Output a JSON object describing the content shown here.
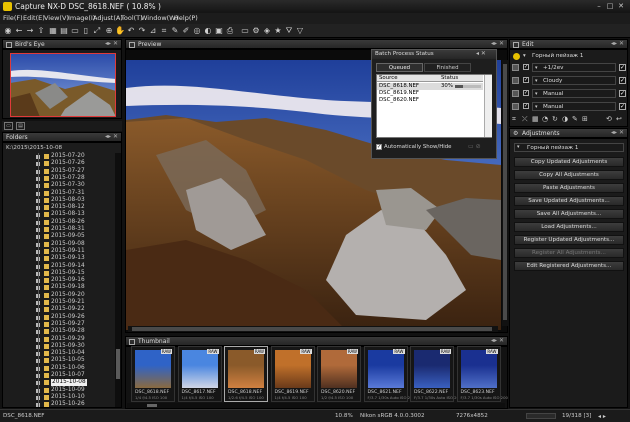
{
  "title": "Capture NX-D    DSC_8618.NEF ( 10.8% )",
  "menu": [
    "File(F)",
    "Edit(E)",
    "View(V)",
    "Image(I)",
    "Adjust(A)",
    "Tool(T)",
    "Window(W)",
    "Help(P)"
  ],
  "panels": {
    "birds_eye": "Bird's Eye",
    "folders": "Folders",
    "preview": "Preview",
    "thumbnail": "Thumbnail",
    "edit": "Edit",
    "adjustments": "Adjustments"
  },
  "folders": {
    "root": "K:\\2015\\2015-10-08",
    "items": [
      "2015-07-20",
      "2015-07-26",
      "2015-07-27",
      "2015-07-28",
      "2015-07-30",
      "2015-07-31",
      "2015-08-03",
      "2015-08-12",
      "2015-08-13",
      "2015-08-26",
      "2015-08-31",
      "2015-09-05",
      "2015-09-08",
      "2015-09-11",
      "2015-09-13",
      "2015-09-14",
      "2015-09-15",
      "2015-09-16",
      "2015-09-18",
      "2015-09-20",
      "2015-09-21",
      "2015-09-22",
      "2015-09-26",
      "2015-09-27",
      "2015-09-28",
      "2015-09-29",
      "2015-09-30",
      "2015-10-04",
      "2015-10-05",
      "2015-10-06",
      "2015-10-07",
      "2015-10-08",
      "2015-10-09",
      "2015-10-10",
      "2015-10-26"
    ],
    "selected": "2015-10-08"
  },
  "batch": {
    "title": "Batch Process Status",
    "tabs": [
      "Queued",
      "Finished"
    ],
    "columns": [
      "Source",
      "Status"
    ],
    "rows": [
      {
        "source": "DSC_8618.NEF",
        "status": "30%",
        "progress": 0.3
      },
      {
        "source": "DSC_8619.NEF",
        "status": ""
      },
      {
        "source": "DSC_8620.NEF",
        "status": ""
      }
    ],
    "auto_show": "Automatically Show/Hide"
  },
  "edit": {
    "preset": "Горный пейзаж 1",
    "rows": [
      "+1/2ev",
      "Cloudy",
      "Manual",
      "Manual"
    ]
  },
  "adjustments": {
    "preset": "Горный пейзаж 1",
    "buttons": [
      {
        "label": "Copy Updated Adjustments",
        "enabled": true
      },
      {
        "label": "Copy All Adjustments",
        "enabled": true
      },
      {
        "label": "Paste Adjustments",
        "enabled": true
      },
      {
        "label": "Save Updated Adjustments...",
        "enabled": true
      },
      {
        "label": "Save All Adjustments...",
        "enabled": true
      },
      {
        "label": "Load Adjustments...",
        "enabled": true
      },
      {
        "label": "Register Updated Adjustments...",
        "enabled": true
      },
      {
        "label": "Register All Adjustments...",
        "enabled": false
      },
      {
        "label": "Edit Registered Adjustments...",
        "enabled": true
      }
    ]
  },
  "thumbnails": [
    {
      "name": "DSC_8618.NEF",
      "meta": "1/4 f/4.5 ISO 100",
      "badge": "RAW"
    },
    {
      "name": "DSC_8617.NEF",
      "meta": "1/4 f/4.5 ISO 100",
      "badge": "RAW"
    },
    {
      "name": "DSC_8618.NEF",
      "meta": "1/2.6 f/4.5 ISO 100",
      "badge": "RAW"
    },
    {
      "name": "DSC_8619.NEF",
      "meta": "1/4 f/4.5 ISO 100",
      "badge": "RAW"
    },
    {
      "name": "DSC_8620.NEF",
      "meta": "1/2 f/4.5 ISO 100",
      "badge": "RAW"
    },
    {
      "name": "DSC_8621.NEF",
      "meta": "F/3.7 1/30s Auto ISO 200",
      "badge": "RAW"
    },
    {
      "name": "DSC_8622.NEF",
      "meta": "F/3.7 1/30s Auto ISO 200",
      "badge": "RAW"
    },
    {
      "name": "DSC_8623.NEF",
      "meta": "F/3.7 1/30s Auto ISO 200",
      "badge": "RAW"
    }
  ],
  "status": {
    "file": "DSC_8618.NEF",
    "zoom": "10.8%",
    "profile": "Nikon sRGB 4.0.0.3002",
    "size": "7276x4852",
    "counter": "19/318 [3]"
  }
}
